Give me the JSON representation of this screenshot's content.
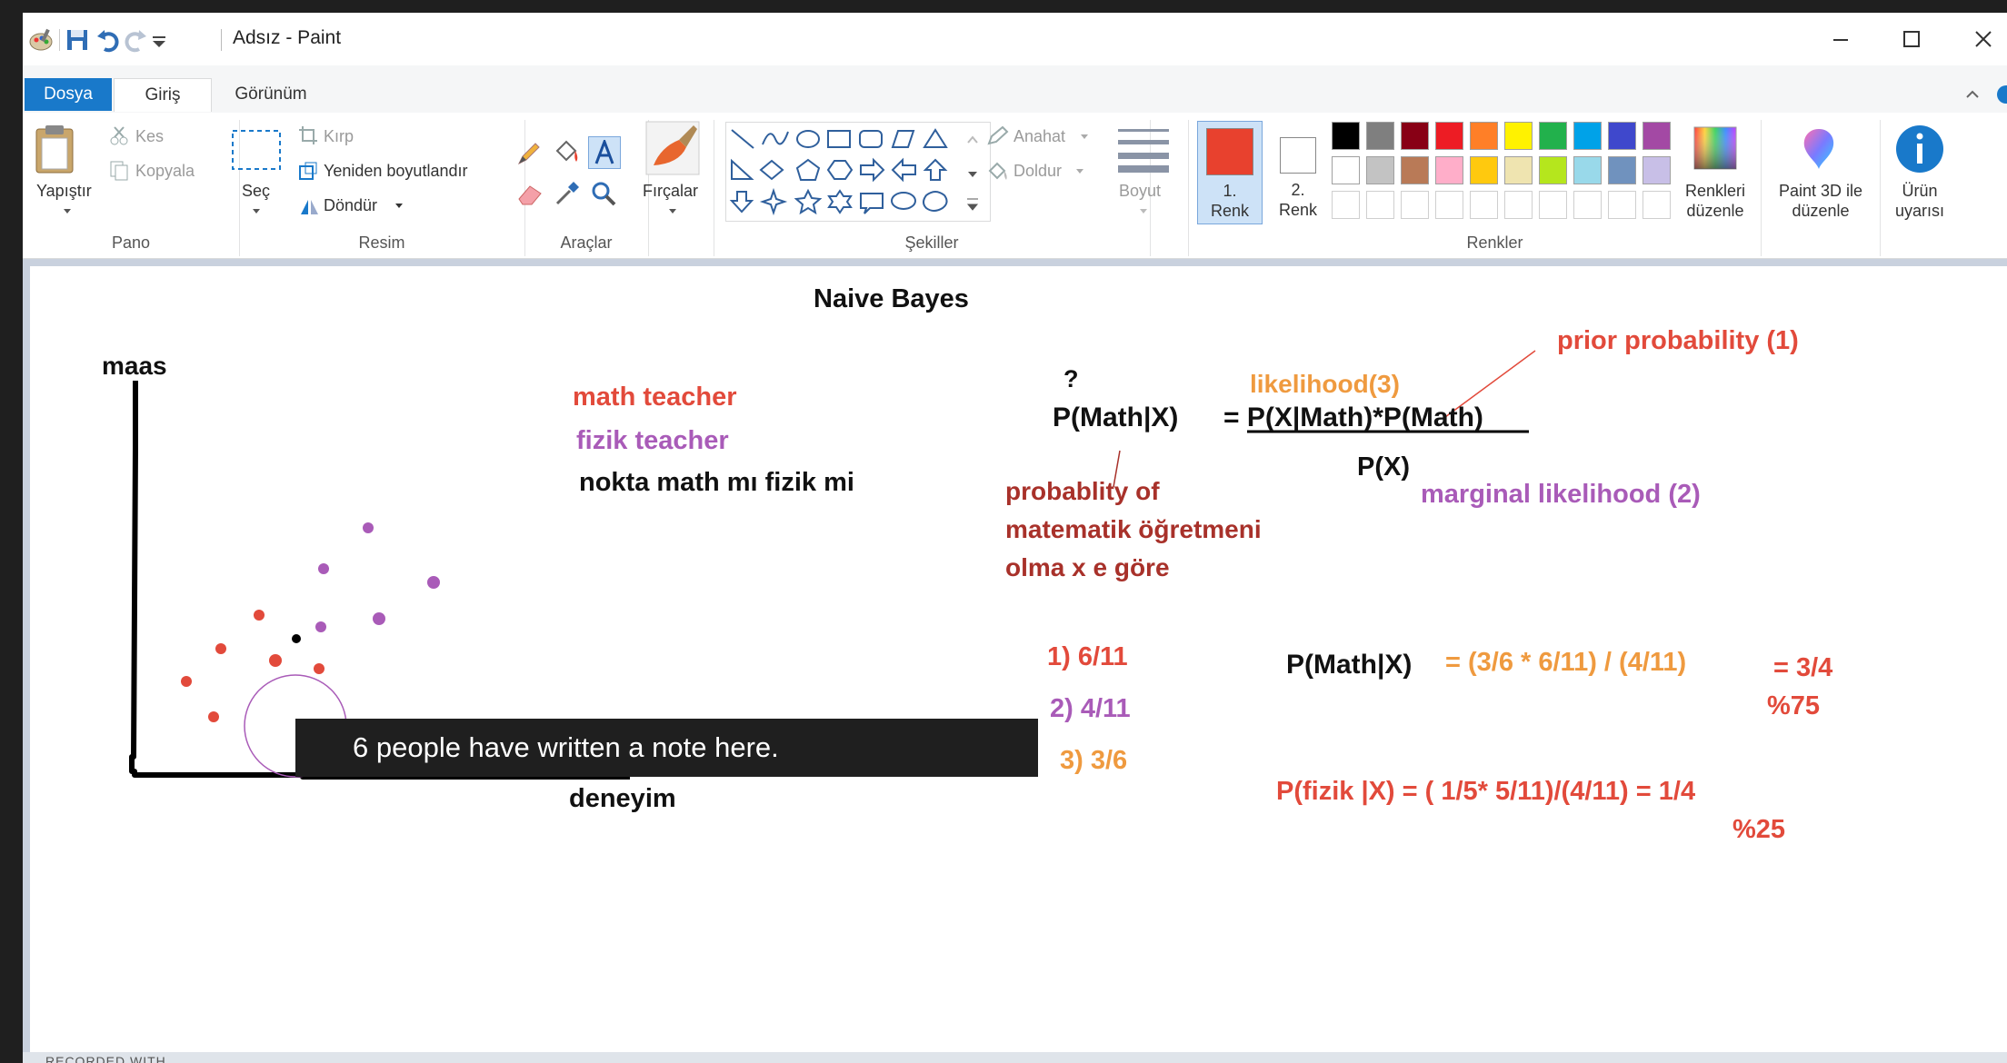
{
  "window": {
    "title": "Adsız - Paint"
  },
  "tabs": {
    "file": "Dosya",
    "home": "Giriş",
    "view": "Görünüm"
  },
  "ribbon": {
    "clipboard": {
      "paste": "Yapıştır",
      "cut": "Kes",
      "copy": "Kopyala",
      "group": "Pano"
    },
    "image": {
      "select": "Seç",
      "crop": "Kırp",
      "resize": "Yeniden boyutlandır",
      "rotate": "Döndür",
      "group": "Resim"
    },
    "tools": {
      "group": "Araçlar"
    },
    "brushes": {
      "label": "Fırçalar"
    },
    "shapes": {
      "outline": "Anahat",
      "fill": "Doldur",
      "group": "Şekiller"
    },
    "size": {
      "label": "Boyut"
    },
    "color1": {
      "line1": "1.",
      "line2": "Renk",
      "value": "#e8412e"
    },
    "color2": {
      "line1": "2.",
      "line2": "Renk",
      "value": "#ffffff"
    },
    "colors": {
      "group": "Renkler",
      "edit_line1": "Renkleri",
      "edit_line2": "düzenle",
      "row1": [
        "#000000",
        "#7f7f7f",
        "#880015",
        "#ed1c24",
        "#ff7f27",
        "#fff200",
        "#22b14c",
        "#00a2e8",
        "#3f48cc",
        "#a349a4"
      ],
      "row2": [
        "#ffffff",
        "#c3c3c3",
        "#b97a57",
        "#ffaec9",
        "#ffc90e",
        "#efe4b0",
        "#b5e61d",
        "#99d9ea",
        "#7092be",
        "#c8bfe7"
      ]
    },
    "paint3d": {
      "line1": "Paint 3D ile",
      "line2": "düzenle"
    },
    "product": {
      "line1": "Ürün",
      "line2": "uyarısı"
    }
  },
  "canvas": {
    "title": "Naive Bayes",
    "y_axis": "maas",
    "x_axis": "deneyim",
    "legend_math": "math teacher",
    "legend_fizik": "fizik teacher",
    "legend_point": "nokta math mı fizik mi",
    "question": "?",
    "lhs": "P(Math|X)",
    "likelihood": "likelihood(3)",
    "prior": "prior probability   (1)",
    "numerator": "= P(X|Math)*P(Math)",
    "denominator": "P(X)",
    "marginal": "marginal likelihood (2)",
    "prob1": "probablity of",
    "prob2": "matematik öğretmeni",
    "prob3": "olma x e göre",
    "step1": "1) 6/11",
    "step2": "2) 4/11",
    "step3": "3) 3/6",
    "calc_lhs": "P(Math|X)",
    "calc_rhs": "= (3/6 * 6/11) / (4/11)",
    "result1": "= 3/4",
    "result1_pct": "%75",
    "fizik_calc": "P(fizik |X) =  ( 1/5* 5/11)/(4/11) = 1/4",
    "fizik_pct": "%25",
    "colors": {
      "math": "#e24a3b",
      "fizik": "#a95bb8",
      "orange": "#ef9a3f",
      "darkred": "#a8312a"
    }
  },
  "subtitle": "6 people have written a note here.",
  "recorded": "RECORDED WITH"
}
